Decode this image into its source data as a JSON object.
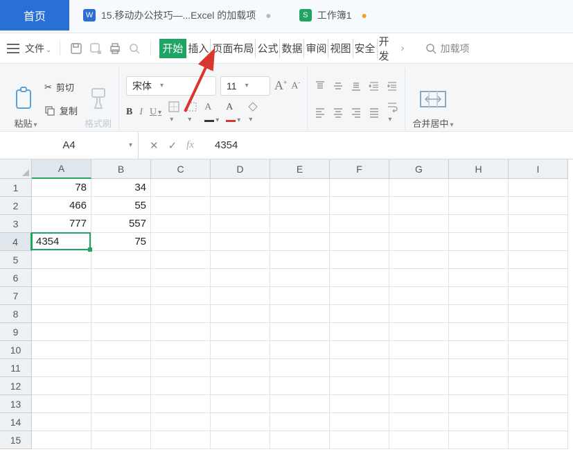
{
  "tabs": {
    "home": "首页",
    "doc1_label": "15.移动办公技巧—...Excel 的加载项",
    "doc2_label": "工作簿1"
  },
  "file_menu": "文件",
  "ribbon_tabs": [
    "开始",
    "插入",
    "页面布局",
    "公式",
    "数据",
    "审阅",
    "视图",
    "安全",
    "开发"
  ],
  "search_placeholder": "加载项",
  "clipboard": {
    "paste": "粘贴",
    "cut": "剪切",
    "copy": "复制",
    "format_painter": "格式刷"
  },
  "font": {
    "name": "宋体",
    "size": "11"
  },
  "merge_label": "合并居中",
  "name_box": "A4",
  "formula_value": "4354",
  "columns": [
    "A",
    "B",
    "C",
    "D",
    "E",
    "F",
    "G",
    "H",
    "I"
  ],
  "row_labels": [
    "1",
    "2",
    "3",
    "4",
    "5",
    "6",
    "7",
    "8",
    "9",
    "10",
    "11",
    "12",
    "13",
    "14",
    "15"
  ],
  "chart_data": {
    "type": "table",
    "columns": [
      "A",
      "B"
    ],
    "rows": [
      {
        "A": "78",
        "B": "34"
      },
      {
        "A": "466",
        "B": "55"
      },
      {
        "A": "777",
        "B": "557"
      },
      {
        "A": "4354",
        "B": "75"
      }
    ]
  },
  "active_cell": {
    "col": 0,
    "row": 3
  }
}
